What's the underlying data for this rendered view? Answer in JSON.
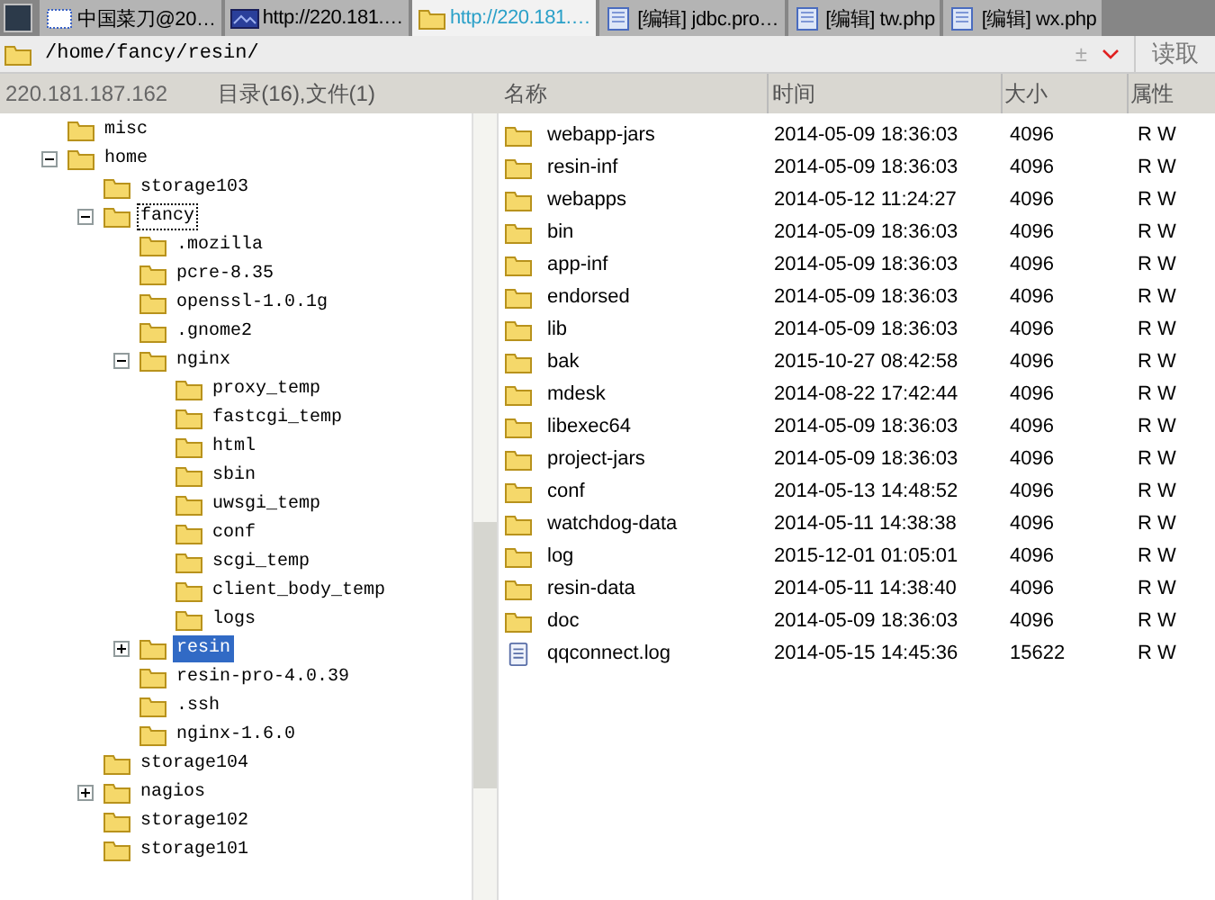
{
  "tabs": [
    {
      "label": "中国菜刀@20…",
      "selected": false,
      "kind": "window"
    },
    {
      "label": "http://220.181.…",
      "selected": false,
      "kind": "web"
    },
    {
      "label": "http://220.181.…",
      "selected": true,
      "kind": "folder"
    },
    {
      "label": "[编辑] jdbc.pro…",
      "selected": false,
      "kind": "doc"
    },
    {
      "label": "[编辑] tw.php",
      "selected": false,
      "kind": "doc"
    },
    {
      "label": "[编辑] wx.php",
      "selected": false,
      "kind": "doc"
    }
  ],
  "address_bar": {
    "path": "/home/fancy/resin/",
    "plus_minus": "±",
    "read_button": "读取"
  },
  "status": {
    "host": "220.181.187.162",
    "summary": "目录(16),文件(1)"
  },
  "tree": [
    {
      "name": "misc",
      "selected": false,
      "focused": false
    },
    {
      "name": "home",
      "expanded": true,
      "selected": false,
      "focused": false,
      "children": [
        {
          "name": "storage103",
          "selected": false,
          "focused": false
        },
        {
          "name": "fancy",
          "expanded": true,
          "selected": false,
          "focused": true,
          "children": [
            {
              "name": ".mozilla",
              "selected": false,
              "focused": false
            },
            {
              "name": "pcre-8.35",
              "selected": false,
              "focused": false
            },
            {
              "name": "openssl-1.0.1g",
              "selected": false,
              "focused": false
            },
            {
              "name": ".gnome2",
              "selected": false,
              "focused": false
            },
            {
              "name": "nginx",
              "expanded": true,
              "selected": false,
              "focused": false,
              "children": [
                {
                  "name": "proxy_temp",
                  "selected": false,
                  "focused": false
                },
                {
                  "name": "fastcgi_temp",
                  "selected": false,
                  "focused": false
                },
                {
                  "name": "html",
                  "selected": false,
                  "focused": false
                },
                {
                  "name": "sbin",
                  "selected": false,
                  "focused": false
                },
                {
                  "name": "uwsgi_temp",
                  "selected": false,
                  "focused": false
                },
                {
                  "name": "conf",
                  "selected": false,
                  "focused": false
                },
                {
                  "name": "scgi_temp",
                  "selected": false,
                  "focused": false
                },
                {
                  "name": "client_body_temp",
                  "selected": false,
                  "focused": false
                },
                {
                  "name": "logs",
                  "selected": false,
                  "focused": false
                }
              ]
            },
            {
              "name": "resin",
              "expanded": false,
              "selected": true,
              "focused": false
            },
            {
              "name": "resin-pro-4.0.39",
              "selected": false,
              "focused": false
            },
            {
              "name": ".ssh",
              "selected": false,
              "focused": false
            },
            {
              "name": "nginx-1.6.0",
              "selected": false,
              "focused": false
            }
          ]
        },
        {
          "name": "storage104",
          "selected": false,
          "focused": false
        },
        {
          "name": "nagios",
          "expanded": false,
          "selected": false,
          "focused": false
        },
        {
          "name": "storage102",
          "selected": false,
          "focused": false
        },
        {
          "name": "storage101",
          "selected": false,
          "focused": false
        }
      ]
    }
  ],
  "table": {
    "columns": [
      "名称",
      "时间",
      "大小",
      "属性"
    ],
    "rows": [
      {
        "kind": "folder",
        "name": "webapp-jars",
        "time": "2014-05-09 18:36:03",
        "size": "4096",
        "attr": "R W"
      },
      {
        "kind": "folder",
        "name": "resin-inf",
        "time": "2014-05-09 18:36:03",
        "size": "4096",
        "attr": "R W"
      },
      {
        "kind": "folder",
        "name": "webapps",
        "time": "2014-05-12 11:24:27",
        "size": "4096",
        "attr": "R W"
      },
      {
        "kind": "folder",
        "name": "bin",
        "time": "2014-05-09 18:36:03",
        "size": "4096",
        "attr": "R W"
      },
      {
        "kind": "folder",
        "name": "app-inf",
        "time": "2014-05-09 18:36:03",
        "size": "4096",
        "attr": "R W"
      },
      {
        "kind": "folder",
        "name": "endorsed",
        "time": "2014-05-09 18:36:03",
        "size": "4096",
        "attr": "R W"
      },
      {
        "kind": "folder",
        "name": "lib",
        "time": "2014-05-09 18:36:03",
        "size": "4096",
        "attr": "R W"
      },
      {
        "kind": "folder",
        "name": "bak",
        "time": "2015-10-27 08:42:58",
        "size": "4096",
        "attr": "R W"
      },
      {
        "kind": "folder",
        "name": "mdesk",
        "time": "2014-08-22 17:42:44",
        "size": "4096",
        "attr": "R W"
      },
      {
        "kind": "folder",
        "name": "libexec64",
        "time": "2014-05-09 18:36:03",
        "size": "4096",
        "attr": "R W"
      },
      {
        "kind": "folder",
        "name": "project-jars",
        "time": "2014-05-09 18:36:03",
        "size": "4096",
        "attr": "R W"
      },
      {
        "kind": "folder",
        "name": "conf",
        "time": "2014-05-13 14:48:52",
        "size": "4096",
        "attr": "R W"
      },
      {
        "kind": "folder",
        "name": "watchdog-data",
        "time": "2014-05-11 14:38:38",
        "size": "4096",
        "attr": "R W"
      },
      {
        "kind": "folder",
        "name": "log",
        "time": "2015-12-01 01:05:01",
        "size": "4096",
        "attr": "R W"
      },
      {
        "kind": "folder",
        "name": "resin-data",
        "time": "2014-05-11 14:38:40",
        "size": "4096",
        "attr": "R W"
      },
      {
        "kind": "folder",
        "name": "doc",
        "time": "2014-05-09 18:36:03",
        "size": "4096",
        "attr": "R W"
      },
      {
        "kind": "file",
        "name": "qqconnect.log",
        "time": "2014-05-15 14:45:36",
        "size": "15622",
        "attr": "R W"
      }
    ]
  }
}
